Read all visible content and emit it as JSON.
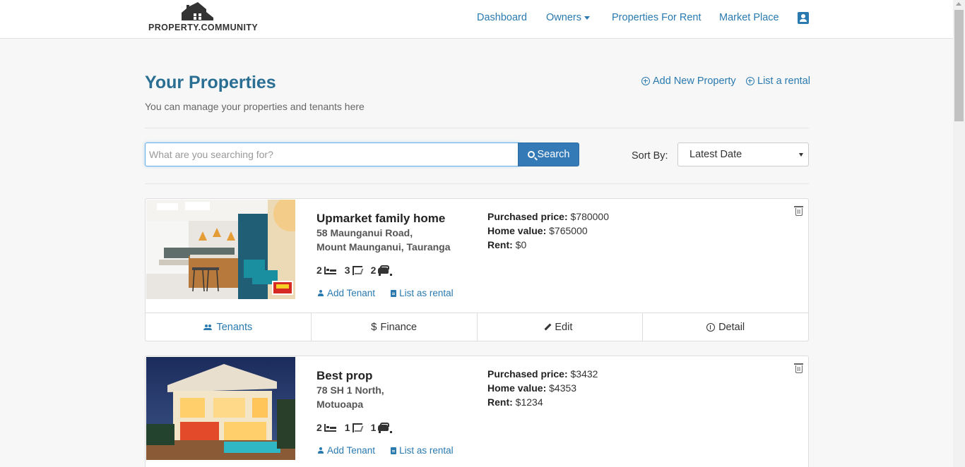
{
  "header": {
    "logo_text": "PROPERTY.COMMUNITY",
    "nav": [
      "Dashboard",
      "Owners",
      "Properties For Rent",
      "Market Place"
    ]
  },
  "page": {
    "title": "Your Properties",
    "subtitle": "You can manage your properties and tenants here",
    "add_property_label": "Add New Property",
    "list_rental_label": "List a rental"
  },
  "search": {
    "placeholder": "What are you searching for?",
    "value": "",
    "button_label": "Search"
  },
  "sort": {
    "label": "Sort By:",
    "selected": "Latest Date"
  },
  "card_labels": {
    "purchased": "Purchased price:",
    "home_value": "Home value:",
    "rent": "Rent:",
    "add_tenant": "Add Tenant",
    "list_as_rental": "List as rental",
    "tenants": "Tenants",
    "finance": "Finance",
    "edit": "Edit",
    "detail": "Detail"
  },
  "properties": [
    {
      "title": "Upmarket family home",
      "address_line1": "58 Maunganui Road,",
      "address_line2": "Mount Maunganui, Tauranga",
      "bedrooms": "2",
      "bathrooms": "3",
      "parking": "2",
      "purchased_price": "$780000",
      "home_value": "$765000",
      "rent": "$0"
    },
    {
      "title": "Best prop",
      "address_line1": "78 SH 1 North,",
      "address_line2": "Motuoapa",
      "bedrooms": "2",
      "bathrooms": "1",
      "parking": "1",
      "purchased_price": "$3432",
      "home_value": "$4353",
      "rent": "$1234"
    }
  ],
  "colors": {
    "link": "#2a7ab0",
    "title": "#2a6f93",
    "primary_button": "#337ab7",
    "page_background": "#f7f7f7"
  }
}
